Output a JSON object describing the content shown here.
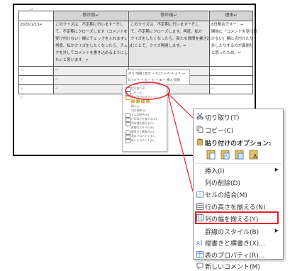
{
  "document": {
    "return_mark": "↵",
    "headers": [
      "修正前↵",
      "修正後↵",
      "理由↵"
    ],
    "row1": {
      "date": "2020/1/15↵",
      "before": [
        "このクイズは、不定期に行います\"\"そし",
        "て、不定期にクローズします（コメントを",
        "受け付けない）欄にチェックを入れます)。",
        "再度、私かクイズをしたくなったら、チェッ",
        "クを外してコメントを書き込めるようにし",
        "たいと思います。↵"
      ],
      "after": [
        "このクイズは、不定期に行います\"\"そし",
        "て、不定期にクローズします。再度、私か",
        "クイズをしたくなったら、新たな質問を書き込",
        "むことで、クイズ再開します。↵"
      ],
      "reason": [
        "8日都合です\"\"：→",
        "開始に「コメントを受け付",
        "けない」欄に点付けたり",
        "外したりするのが面倒だ",
        "と思ったため。↵"
      ]
    },
    "empty_mark": "↵"
  },
  "mini_toolbar": {
    "row1": "ＭＳ 明朝 (本文 ~ 10.5 ~ A' A' ⍝ ✎ ▭",
    "row2": "B I ≡ ✎ ~ A ~ ◫ ~ ⊞ ~ 挿入 削除"
  },
  "mini_menu": [
    "切り取り(T)",
    "コピー(C)",
    "貼り付けのオプション:",
    "",
    "挿入(I)",
    "列の削除(D)",
    "セルの結合(M)",
    "行の高さを揃える(N)",
    "列の幅を揃える(Y)",
    "罫線のスタイル(B)",
    "縦書きと横書き(X)...",
    "表のプロパティ(R)...",
    "新しいコメント(M)"
  ],
  "zoom_menu": {
    "cut": "切り取り(T)",
    "copy": "コピー(C)",
    "paste_options": "貼り付けのオプション:",
    "insert": "挿入(I)",
    "delete_column": "列の削除(D)",
    "merge_cells": "セルの結合(M)",
    "distribute_rows": "行の高さを揃える(N)",
    "distribute_columns": "列の幅を揃える(Y)",
    "border_styles": "罫線のスタイル(B)",
    "text_direction": "縦書きと横書き(X)...",
    "table_properties": "表のプロパティ(R)...",
    "new_comment": "新しいコメント(M)"
  },
  "colors": {
    "highlight": "#e8202a",
    "header_fill": "#d4d4d4",
    "paste_icon": "#c9a13b"
  }
}
